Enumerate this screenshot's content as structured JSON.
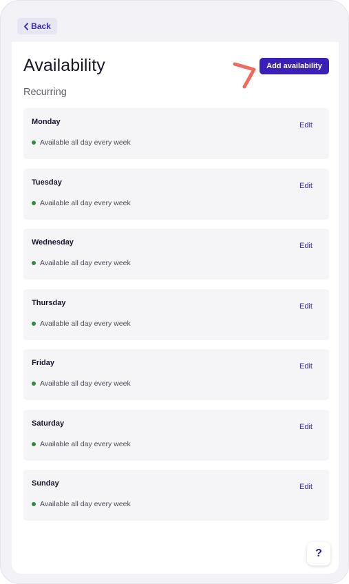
{
  "header": {
    "back_label": "Back",
    "back_icon": "chevron-left-icon"
  },
  "page": {
    "title": "Availability",
    "add_button_label": "Add availability",
    "section_title": "Recurring"
  },
  "days": [
    {
      "name": "Monday",
      "status": "Available all day every week",
      "edit_label": "Edit"
    },
    {
      "name": "Tuesday",
      "status": "Available all day every week",
      "edit_label": "Edit"
    },
    {
      "name": "Wednesday",
      "status": "Available all day every week",
      "edit_label": "Edit"
    },
    {
      "name": "Thursday",
      "status": "Available all day every week",
      "edit_label": "Edit"
    },
    {
      "name": "Friday",
      "status": "Available all day every week",
      "edit_label": "Edit"
    },
    {
      "name": "Saturday",
      "status": "Available all day every week",
      "edit_label": "Edit"
    },
    {
      "name": "Sunday",
      "status": "Available all day every week",
      "edit_label": "Edit"
    }
  ],
  "help": {
    "label": "?"
  },
  "colors": {
    "accent": "#3a1fb8",
    "status_available": "#2e8b3e",
    "annotation_arrow": "#f06a5e"
  }
}
